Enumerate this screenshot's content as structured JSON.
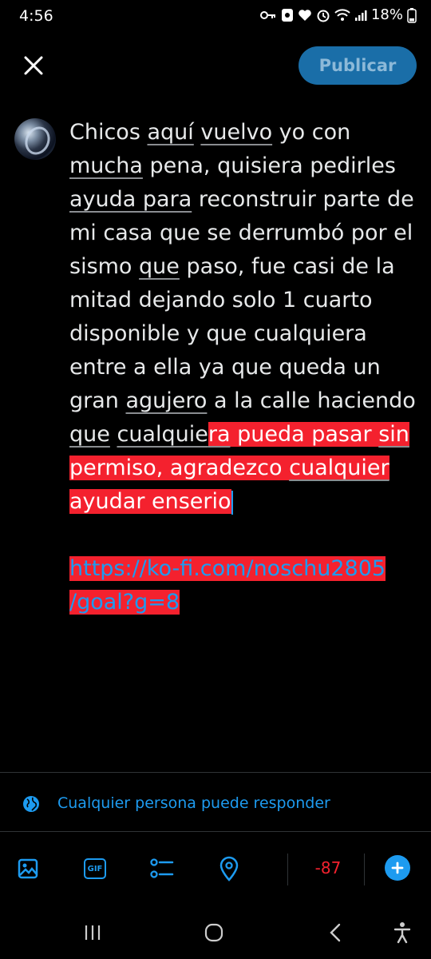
{
  "status_bar": {
    "time": "4:56",
    "battery": "18%",
    "icons": [
      "key-icon",
      "notification-icon",
      "heart-icon",
      "alarm-icon",
      "wifi-icon",
      "signal-icon",
      "battery-icon"
    ]
  },
  "header": {
    "close_icon": "close-icon",
    "publish_label": "Publicar"
  },
  "composer": {
    "lines": [
      [
        {
          "t": "Chicos "
        },
        {
          "t": "aquí",
          "u": true
        },
        {
          "t": " "
        },
        {
          "t": "vuelvo",
          "u": true
        },
        {
          "t": " yo con"
        }
      ],
      [
        {
          "t": "mucha",
          "u": true
        },
        {
          "t": " pena, quisiera pedirles"
        }
      ],
      [
        {
          "t": "ayuda para",
          "u": true
        },
        {
          "t": " reconstruir parte de"
        }
      ],
      [
        {
          "t": "mi casa que se derrumbó por el"
        }
      ],
      [
        {
          "t": "sismo "
        },
        {
          "t": "que",
          "u": true
        },
        {
          "t": " paso, fue casi de la"
        }
      ],
      [
        {
          "t": "mitad dejando solo 1 cuarto"
        }
      ],
      [
        {
          "t": "disponible y que cualquiera"
        }
      ],
      [
        {
          "t": "entre a ella ya que queda un"
        }
      ],
      [
        {
          "t": "gran "
        },
        {
          "t": "agujero",
          "u": true
        },
        {
          "t": " a la calle haciendo"
        }
      ],
      [
        {
          "t": "que",
          "u": true
        },
        {
          "t": " "
        },
        {
          "t": "cualquie",
          "u": true
        },
        {
          "t": "ra",
          "u": true,
          "hl": true
        },
        {
          "t": " pueda pasar ",
          "hl": true
        },
        {
          "t": "sin",
          "u": true,
          "hl": true
        }
      ],
      [
        {
          "t": "permiso, agradezco ",
          "hl": true
        },
        {
          "t": "cualquier",
          "u": true,
          "hl": true
        }
      ],
      [
        {
          "t": "ayudar enserio",
          "hl": true
        },
        {
          "cursor": true
        }
      ],
      [],
      [
        {
          "t": "https://ko-fi.com/noschu2805",
          "link": true,
          "hl": true
        }
      ],
      [
        {
          "t": "/goal?g=8",
          "link": true,
          "hl": true
        }
      ]
    ]
  },
  "reply_settings": {
    "icon": "globe-icon",
    "label": "Cualquier persona puede responder"
  },
  "toolbar": {
    "tools": [
      "image-icon",
      "gif-icon",
      "poll-icon",
      "location-icon"
    ],
    "gif_label": "GIF",
    "char_counter": "-87",
    "add_icon": "plus-icon"
  },
  "nav_bar": [
    "recent-apps-icon",
    "home-icon",
    "back-icon",
    "accessibility-icon"
  ],
  "colors": {
    "accent": "#1d9bf0",
    "publish_bg": "#1a6ea8",
    "highlight": "#f4212e",
    "background": "#000000"
  }
}
